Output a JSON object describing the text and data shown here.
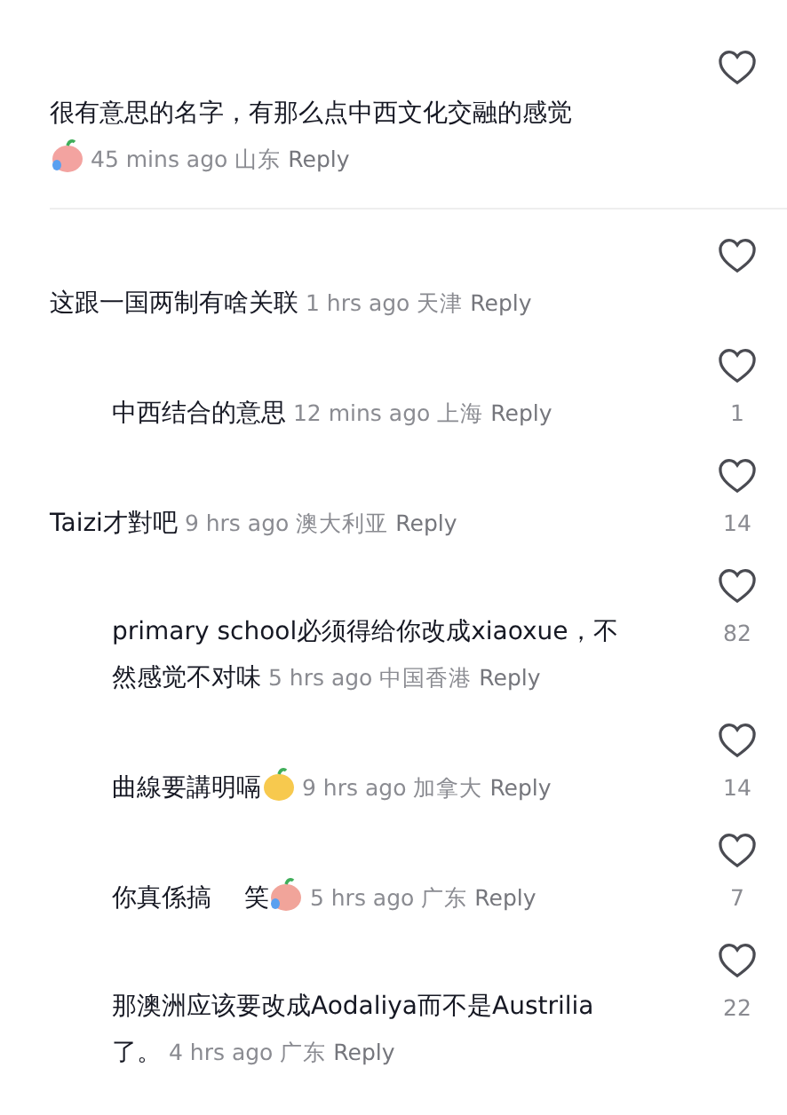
{
  "comments": [
    {
      "nested": false,
      "text": "很有意思的名字，有那么点中西文化交融的感觉",
      "sticker": {
        "kind": "crying"
      },
      "meta_on_new_line": true,
      "time": "45 mins ago",
      "location": "山东",
      "reply": "Reply",
      "divider_after": true
    },
    {
      "nested": false,
      "text": "这跟一国两制有啥关联",
      "time": "1 hrs ago",
      "location": "天津",
      "reply": "Reply"
    },
    {
      "nested": true,
      "text": "中西结合的意思",
      "time": "12 mins ago",
      "location": "上海",
      "reply": "Reply",
      "likes": "1"
    },
    {
      "nested": false,
      "text": "Taizi才對吧",
      "time": "9 hrs ago",
      "location": "澳大利亚",
      "reply": "Reply",
      "likes": "14"
    },
    {
      "nested": true,
      "text": "primary school必须得给你改成xiaoxue，不然感觉不对味",
      "time": "5 hrs ago",
      "location": "中国香港",
      "reply": "Reply",
      "likes": "82"
    },
    {
      "nested": true,
      "text": "曲線要講明嗝",
      "sticker": {
        "kind": "dizzy"
      },
      "time": "9 hrs ago",
      "location": "加拿大",
      "reply": "Reply",
      "likes": "14"
    },
    {
      "nested": true,
      "text": "你真係搞　 笑",
      "sticker": {
        "kind": "sweat"
      },
      "time": "5 hrs ago",
      "location": "广东",
      "reply": "Reply",
      "likes": "7"
    },
    {
      "nested": true,
      "text": "那澳洲应该要改成Aodaliya而不是Austrilia了。",
      "time": "4 hrs ago",
      "location": "广东",
      "reply": "Reply",
      "likes": "22"
    }
  ]
}
